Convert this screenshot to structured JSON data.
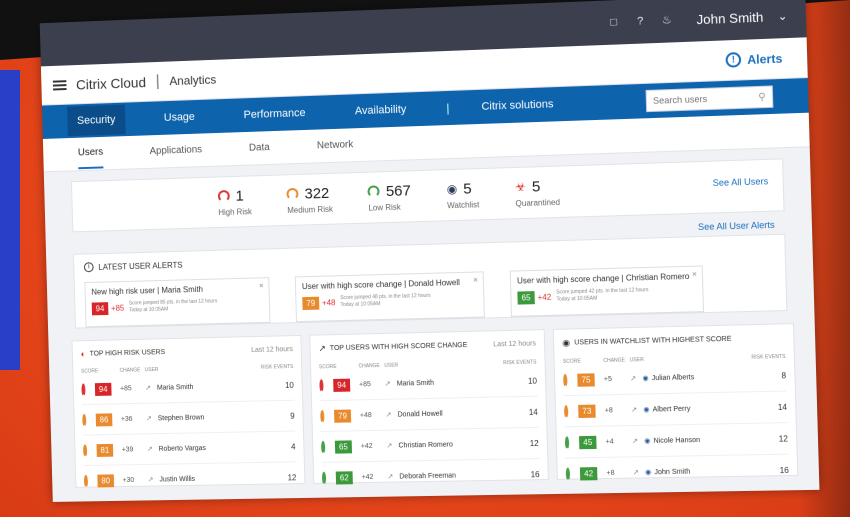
{
  "topbar": {
    "user_name": "John Smith",
    "chat_icon": "chat-icon",
    "help_icon": "help-icon",
    "bell_icon": "bell-icon"
  },
  "header": {
    "brand": "Citrix Cloud",
    "section": "Analytics",
    "alerts_label": "Alerts"
  },
  "nav": {
    "tabs": [
      {
        "label": "Security"
      },
      {
        "label": "Usage"
      },
      {
        "label": "Performance"
      },
      {
        "label": "Availability"
      }
    ],
    "solutions_label": "Citrix solutions",
    "search_placeholder": "Search users"
  },
  "subtabs": [
    {
      "label": "Users"
    },
    {
      "label": "Applications"
    },
    {
      "label": "Data"
    },
    {
      "label": "Network"
    }
  ],
  "summary": {
    "high_risk": {
      "value": "1",
      "label": "High Risk"
    },
    "medium_risk": {
      "value": "322",
      "label": "Medium Risk"
    },
    "low_risk": {
      "value": "567",
      "label": "Low Risk"
    },
    "watchlist": {
      "value": "5",
      "label": "Watchlist"
    },
    "quarantined": {
      "value": "5",
      "label": "Quarantined"
    },
    "see_all": "See All Users"
  },
  "alerts_section": {
    "see_all": "See All User Alerts",
    "title": "LATEST USER ALERTS",
    "cards": [
      {
        "title": "New high risk user | Maria Smith",
        "score": "94",
        "delta": "+85",
        "meta": "Score jumped 85 pts. in the last 12 hours",
        "time": "Today at 10:05AM"
      },
      {
        "title": "User with high score change | Donald Howell",
        "score": "79",
        "delta": "+48",
        "meta": "Score jumped 48 pts. in the last 12 hours",
        "time": "Today at 10:05AM"
      },
      {
        "title": "User with high score change | Christian Romero",
        "score": "65",
        "delta": "+42",
        "meta": "Score jumped 42 pts. in the last 12 hours",
        "time": "Today at 10:05AM"
      }
    ]
  },
  "panels": [
    {
      "title": "TOP HIGH RISK USERS",
      "subtitle": "Last 12 hours",
      "cols": {
        "score": "SCORE",
        "change": "CHANGE",
        "user": "USER",
        "events": "RISK EVENTS"
      },
      "rows": [
        {
          "score": "94",
          "change": "+85",
          "user": "Maria Smith",
          "events": "10"
        },
        {
          "score": "86",
          "change": "+36",
          "user": "Stephen Brown",
          "events": "9"
        },
        {
          "score": "81",
          "change": "+39",
          "user": "Roberto Vargas",
          "events": "4"
        },
        {
          "score": "80",
          "change": "+30",
          "user": "Justin Willis",
          "events": "12"
        }
      ]
    },
    {
      "title": "TOP USERS WITH HIGH SCORE CHANGE",
      "subtitle": "Last 12 hours",
      "cols": {
        "score": "SCORE",
        "change": "CHANGE",
        "user": "USER",
        "events": "RISK EVENTS"
      },
      "rows": [
        {
          "score": "94",
          "change": "+85",
          "user": "Maria Smith",
          "events": "10"
        },
        {
          "score": "79",
          "change": "+48",
          "user": "Donald Howell",
          "events": "14"
        },
        {
          "score": "65",
          "change": "+42",
          "user": "Christian Romero",
          "events": "12"
        },
        {
          "score": "62",
          "change": "+42",
          "user": "Deborah Freeman",
          "events": "16"
        }
      ]
    },
    {
      "title": "USERS IN WATCHLIST WITH HIGHEST SCORE",
      "subtitle": "",
      "cols": {
        "score": "SCORE",
        "change": "CHANGE",
        "user": "USER",
        "events": "RISK EVENTS"
      },
      "rows": [
        {
          "score": "75",
          "change": "+5",
          "user": "Julian Alberts",
          "events": "8"
        },
        {
          "score": "73",
          "change": "+8",
          "user": "Albert Perry",
          "events": "14"
        },
        {
          "score": "45",
          "change": "+4",
          "user": "Nicole Hanson",
          "events": "12"
        },
        {
          "score": "42",
          "change": "+8",
          "user": "John Smith",
          "events": "16"
        }
      ]
    }
  ]
}
